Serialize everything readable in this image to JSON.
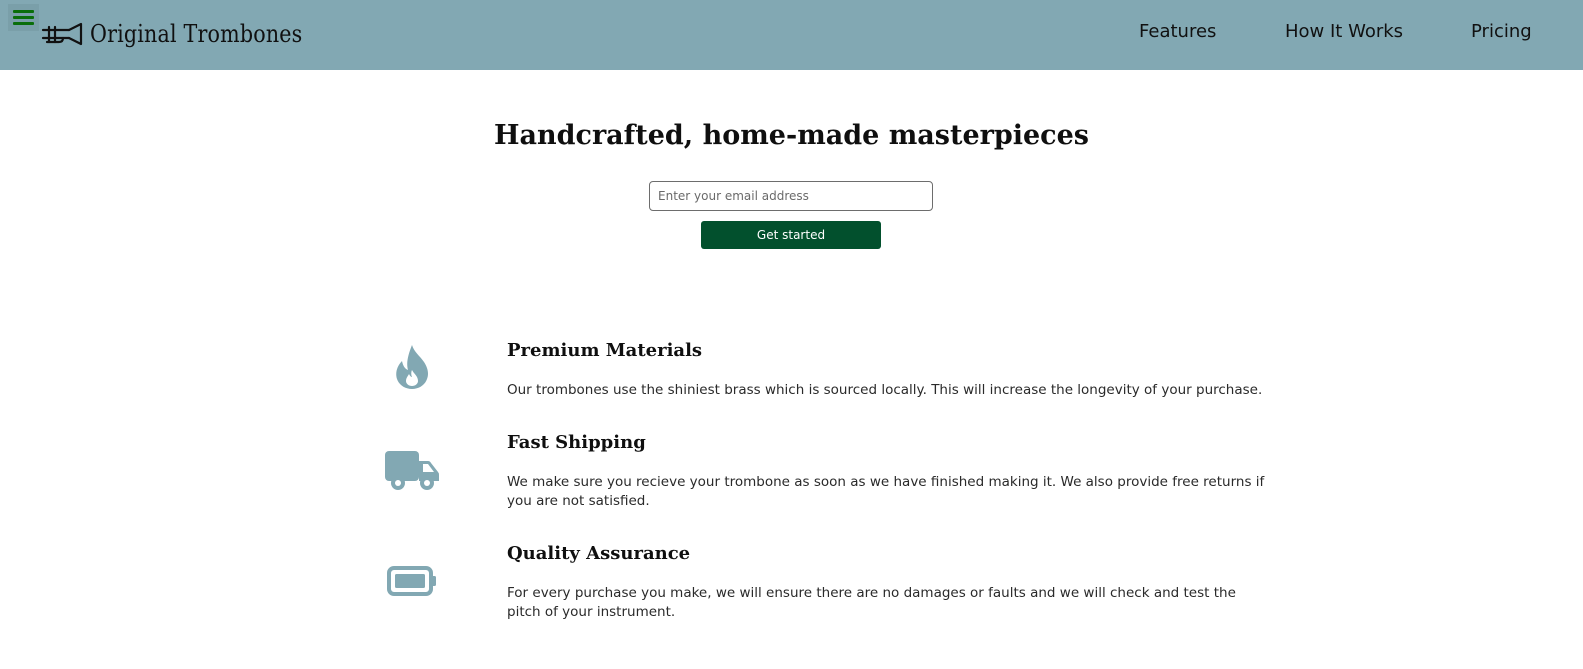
{
  "header": {
    "brand": "Original Trombones",
    "nav": [
      {
        "label": "Features"
      },
      {
        "label": "How It Works"
      },
      {
        "label": "Pricing"
      }
    ]
  },
  "hero": {
    "title": "Handcrafted, home-made masterpieces",
    "email_placeholder": "Enter your email address",
    "email_value": "",
    "cta_label": "Get started"
  },
  "features": [
    {
      "icon": "flame-icon",
      "title": "Premium Materials",
      "description": "Our trombones use the shiniest brass which is sourced locally. This will increase the longevity of your purchase."
    },
    {
      "icon": "truck-icon",
      "title": "Fast Shipping",
      "description": "We make sure you recieve your trombone as soon as we have finished making it. We also provide free returns if you are not satisfied."
    },
    {
      "icon": "battery-icon",
      "title": "Quality Assurance",
      "description": "For every purchase you make, we will ensure there are no damages or faults and we will check and test the pitch of your instrument."
    }
  ],
  "colors": {
    "header_bg": "#82a8b3",
    "accent": "#02502d",
    "icon": "#82a8b3",
    "menu_lines": "#0a6e0a"
  }
}
